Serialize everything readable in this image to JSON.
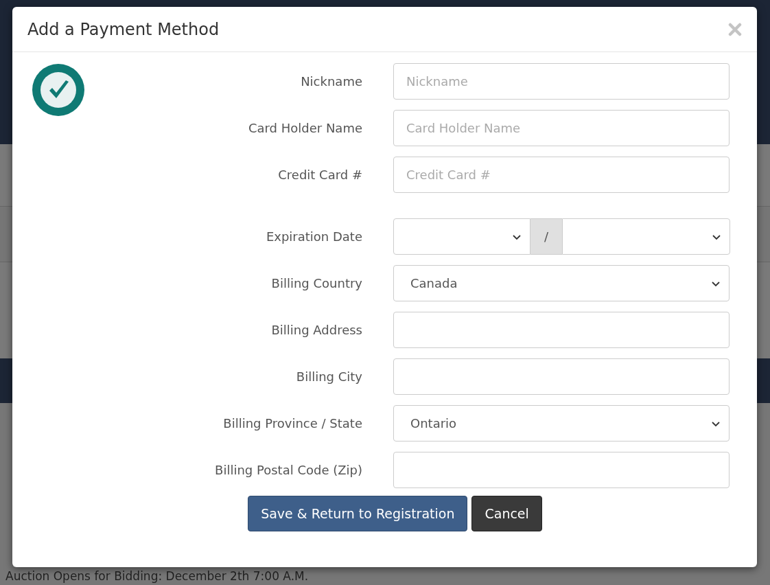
{
  "background": {
    "footer_text": "Auction Opens for Bidding: December 2th 7:00 A.M."
  },
  "modal": {
    "title": "Add a Payment Method",
    "fields": [
      {
        "kind": "text",
        "label": "Nickname",
        "placeholder": "Nickname"
      },
      {
        "kind": "text",
        "label": "Card Holder Name",
        "placeholder": "Card Holder Name"
      },
      {
        "kind": "text",
        "label": "Credit Card #",
        "placeholder": "Credit Card #"
      },
      {
        "kind": "expiry",
        "label": "Expiration Date",
        "separator": "/"
      },
      {
        "kind": "select",
        "label": "Billing Country",
        "value": "Canada"
      },
      {
        "kind": "text",
        "label": "Billing Address"
      },
      {
        "kind": "text",
        "label": "Billing City"
      },
      {
        "kind": "select",
        "label": "Billing Province / State",
        "value": "Ontario"
      },
      {
        "kind": "text",
        "label": "Billing Postal Code (Zip)"
      }
    ],
    "buttons": [
      {
        "kind": "primary",
        "label": "Save & Return to Registration"
      },
      {
        "kind": "dark",
        "label": "Cancel"
      }
    ]
  }
}
